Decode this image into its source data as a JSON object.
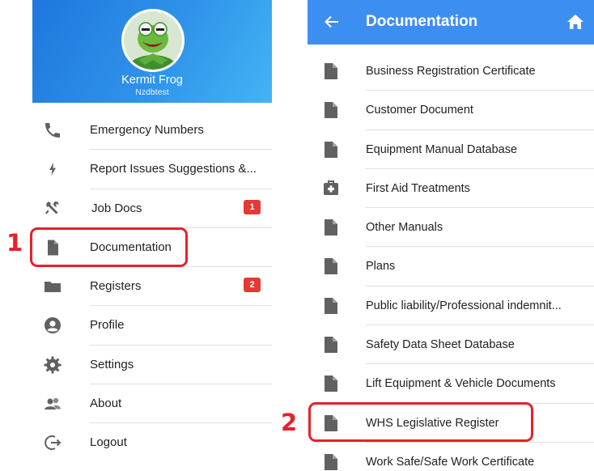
{
  "drawer": {
    "user_name": "Kermit Frog",
    "user_sub": "Nzdbtest",
    "items": [
      {
        "label": "Emergency Numbers",
        "icon": "phone-icon"
      },
      {
        "label": "Report Issues Suggestions &...",
        "icon": "bolt-icon"
      },
      {
        "label": "Job Docs",
        "icon": "tools-icon",
        "badge": "1"
      },
      {
        "label": "Documentation",
        "icon": "document-icon"
      },
      {
        "label": "Registers",
        "icon": "folder-icon",
        "badge": "2"
      },
      {
        "label": "Profile",
        "icon": "profile-icon"
      },
      {
        "label": "Settings",
        "icon": "settings-icon"
      },
      {
        "label": "About",
        "icon": "about-icon"
      },
      {
        "label": "Logout",
        "icon": "logout-icon"
      }
    ]
  },
  "docs": {
    "title": "Documentation",
    "items": [
      {
        "label": "Business Registration Certificate",
        "icon": "document-icon"
      },
      {
        "label": "Customer Document",
        "icon": "document-icon"
      },
      {
        "label": "Equipment Manual Database",
        "icon": "document-icon"
      },
      {
        "label": "First Aid Treatments",
        "icon": "first-aid-icon"
      },
      {
        "label": "Other Manuals",
        "icon": "document-icon"
      },
      {
        "label": "Plans",
        "icon": "document-icon"
      },
      {
        "label": "Public liability/Professional indemnit...",
        "icon": "document-icon"
      },
      {
        "label": "Safety Data Sheet Database",
        "icon": "document-icon"
      },
      {
        "label": "Lift Equipment & Vehicle Documents",
        "icon": "document-icon"
      },
      {
        "label": "WHS Legislative Register",
        "icon": "document-icon"
      },
      {
        "label": "Work Safe/Safe Work Certificate",
        "icon": "document-icon"
      }
    ]
  },
  "annotations": {
    "step1": "1",
    "step2": "2"
  },
  "colors": {
    "header_gradient_start": "#1f77dd",
    "header_gradient_end": "#43b4f4",
    "topbar": "#3d8ef1",
    "badge": "#e53935",
    "annotation": "#e8202b",
    "icon_gray": "#616161"
  }
}
